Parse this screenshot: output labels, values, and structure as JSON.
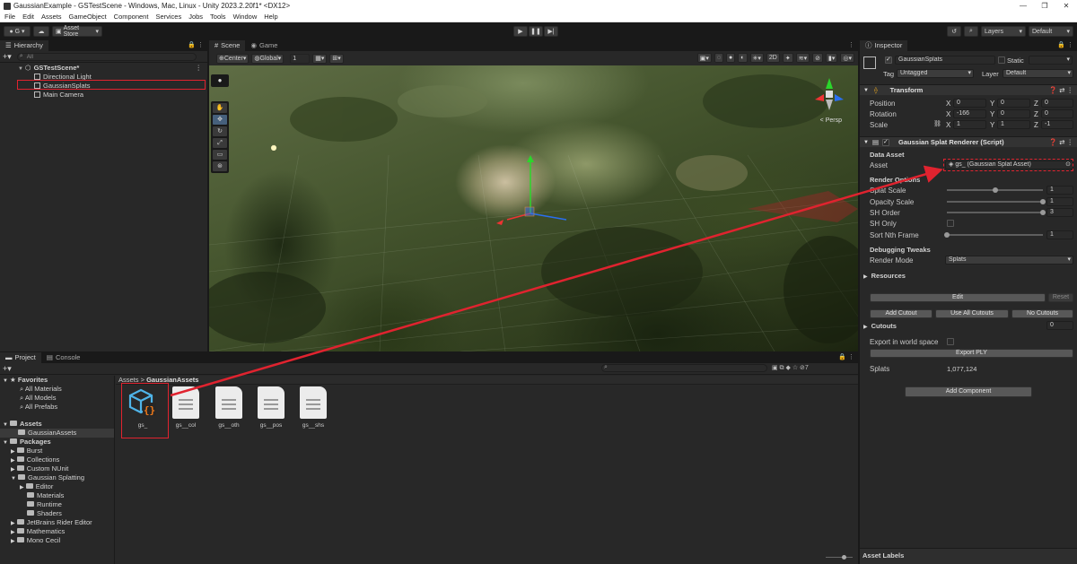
{
  "window": {
    "title": "GaussianExample - GSTestScene - Windows, Mac, Linux - Unity 2023.2.20f1* <DX12>",
    "controls": [
      "—",
      "❐",
      "✕"
    ]
  },
  "menu": [
    "File",
    "Edit",
    "Assets",
    "GameObject",
    "Component",
    "Services",
    "Jobs",
    "Tools",
    "Window",
    "Help"
  ],
  "toolbar": {
    "account": "G",
    "asset_store": "Asset Store",
    "layers": "Layers",
    "layout": "Default"
  },
  "hierarchy": {
    "tab": "Hierarchy",
    "search_placeholder": "All",
    "scene": "GSTestScene*",
    "items": [
      "Directional Light",
      "GaussianSplats",
      "Main Camera"
    ]
  },
  "scene": {
    "tabs": [
      "Scene",
      "Game"
    ],
    "pivot": "Center",
    "space": "Global",
    "snap": "1",
    "view_2d": "2D",
    "persp_label": "< Persp"
  },
  "inspector": {
    "tab": "Inspector",
    "object_name": "GaussianSplats",
    "static_label": "Static",
    "tag_label": "Tag",
    "tag_value": "Untagged",
    "layer_label": "Layer",
    "layer_value": "Default",
    "transform": {
      "title": "Transform",
      "position_label": "Position",
      "rotation_label": "Rotation",
      "scale_label": "Scale",
      "position": [
        "0",
        "0",
        "0"
      ],
      "rotation": [
        "-166",
        "0",
        "0"
      ],
      "scale": [
        "1",
        "1",
        "-1"
      ],
      "axes": [
        "X",
        "Y",
        "Z"
      ]
    },
    "renderer": {
      "title": "Gaussian Splat Renderer (Script)",
      "data_asset": "Data Asset",
      "asset_label": "Asset",
      "asset_value": "gs_ (Gaussian Splat Asset)",
      "render_options": "Render Options",
      "splat_scale_label": "Splat Scale",
      "splat_scale": "1",
      "splat_scale_frac": 0.5,
      "opacity_scale_label": "Opacity Scale",
      "opacity_scale": "1",
      "opacity_scale_frac": 1.0,
      "sh_order_label": "SH Order",
      "sh_order": "3",
      "sh_order_frac": 1.0,
      "sh_only_label": "SH Only",
      "sort_nth_label": "Sort Nth Frame",
      "sort_nth": "1",
      "sort_nth_frac": 0.0,
      "debugging": "Debugging Tweaks",
      "render_mode_label": "Render Mode",
      "render_mode": "Splats",
      "resources": "Resources",
      "edit": "Edit",
      "reset": "Reset",
      "add_cutout": "Add Cutout",
      "use_all_cutouts": "Use All Cutouts",
      "no_cutouts": "No Cutouts",
      "cutouts_label": "Cutouts",
      "cutouts_count": "0",
      "export_world_label": "Export in world space",
      "export_ply": "Export PLY",
      "splats_label": "Splats",
      "splats_count": "1,077,124"
    },
    "add_component": "Add Component",
    "asset_labels": "Asset Labels"
  },
  "project": {
    "tabs": [
      "Project",
      "Console"
    ],
    "favorites": "Favorites",
    "favorite_items": [
      "All Materials",
      "All Models",
      "All Prefabs"
    ],
    "assets": "Assets",
    "assets_children": [
      "GaussianAssets"
    ],
    "packages": "Packages",
    "package_items": [
      "Burst",
      "Collections",
      "Custom NUnit",
      "Gaussian Splatting"
    ],
    "gs_children": [
      "Editor",
      "Materials",
      "Runtime",
      "Shaders"
    ],
    "package_items_after": [
      "JetBrains Rider Editor",
      "Mathematics",
      "Mono Cecil"
    ],
    "breadcrumb_root": "Assets",
    "breadcrumb_current": "GaussianAssets",
    "files": [
      "gs_",
      "gs__col",
      "gs__oth",
      "gs__pos",
      "gs__shs"
    ],
    "hidden_count": "7"
  },
  "colors": {
    "accent_red": "#e0232f",
    "selection": "#2c5d87",
    "panel": "#282828"
  }
}
